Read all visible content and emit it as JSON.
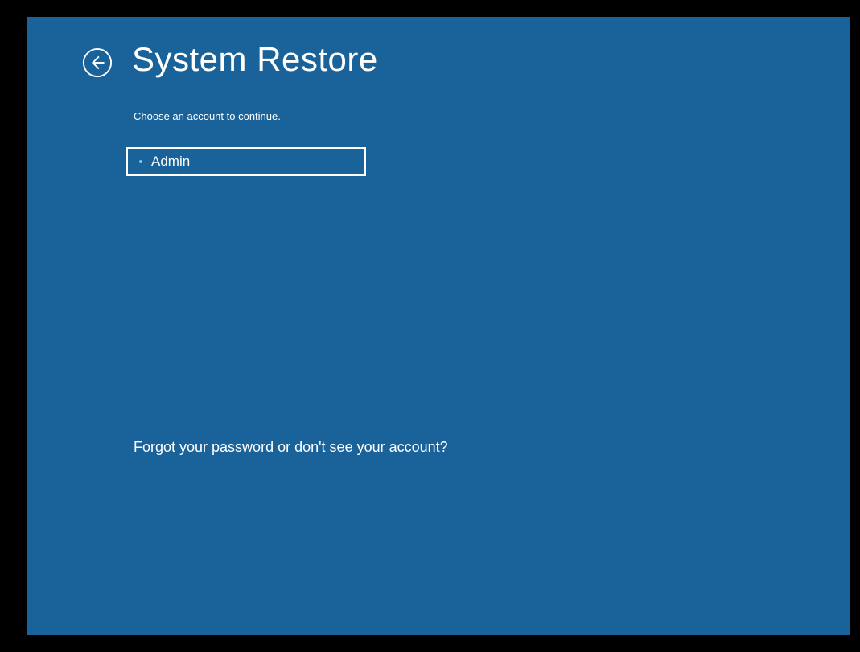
{
  "header": {
    "title": "System Restore"
  },
  "subtitle": "Choose an account to continue.",
  "accounts": [
    {
      "label": "Admin"
    }
  ],
  "forgot_text": "Forgot your password or don't see your account?",
  "colors": {
    "background": "#19629a",
    "text": "#ffffff",
    "bullet": "#7fc4e8"
  }
}
